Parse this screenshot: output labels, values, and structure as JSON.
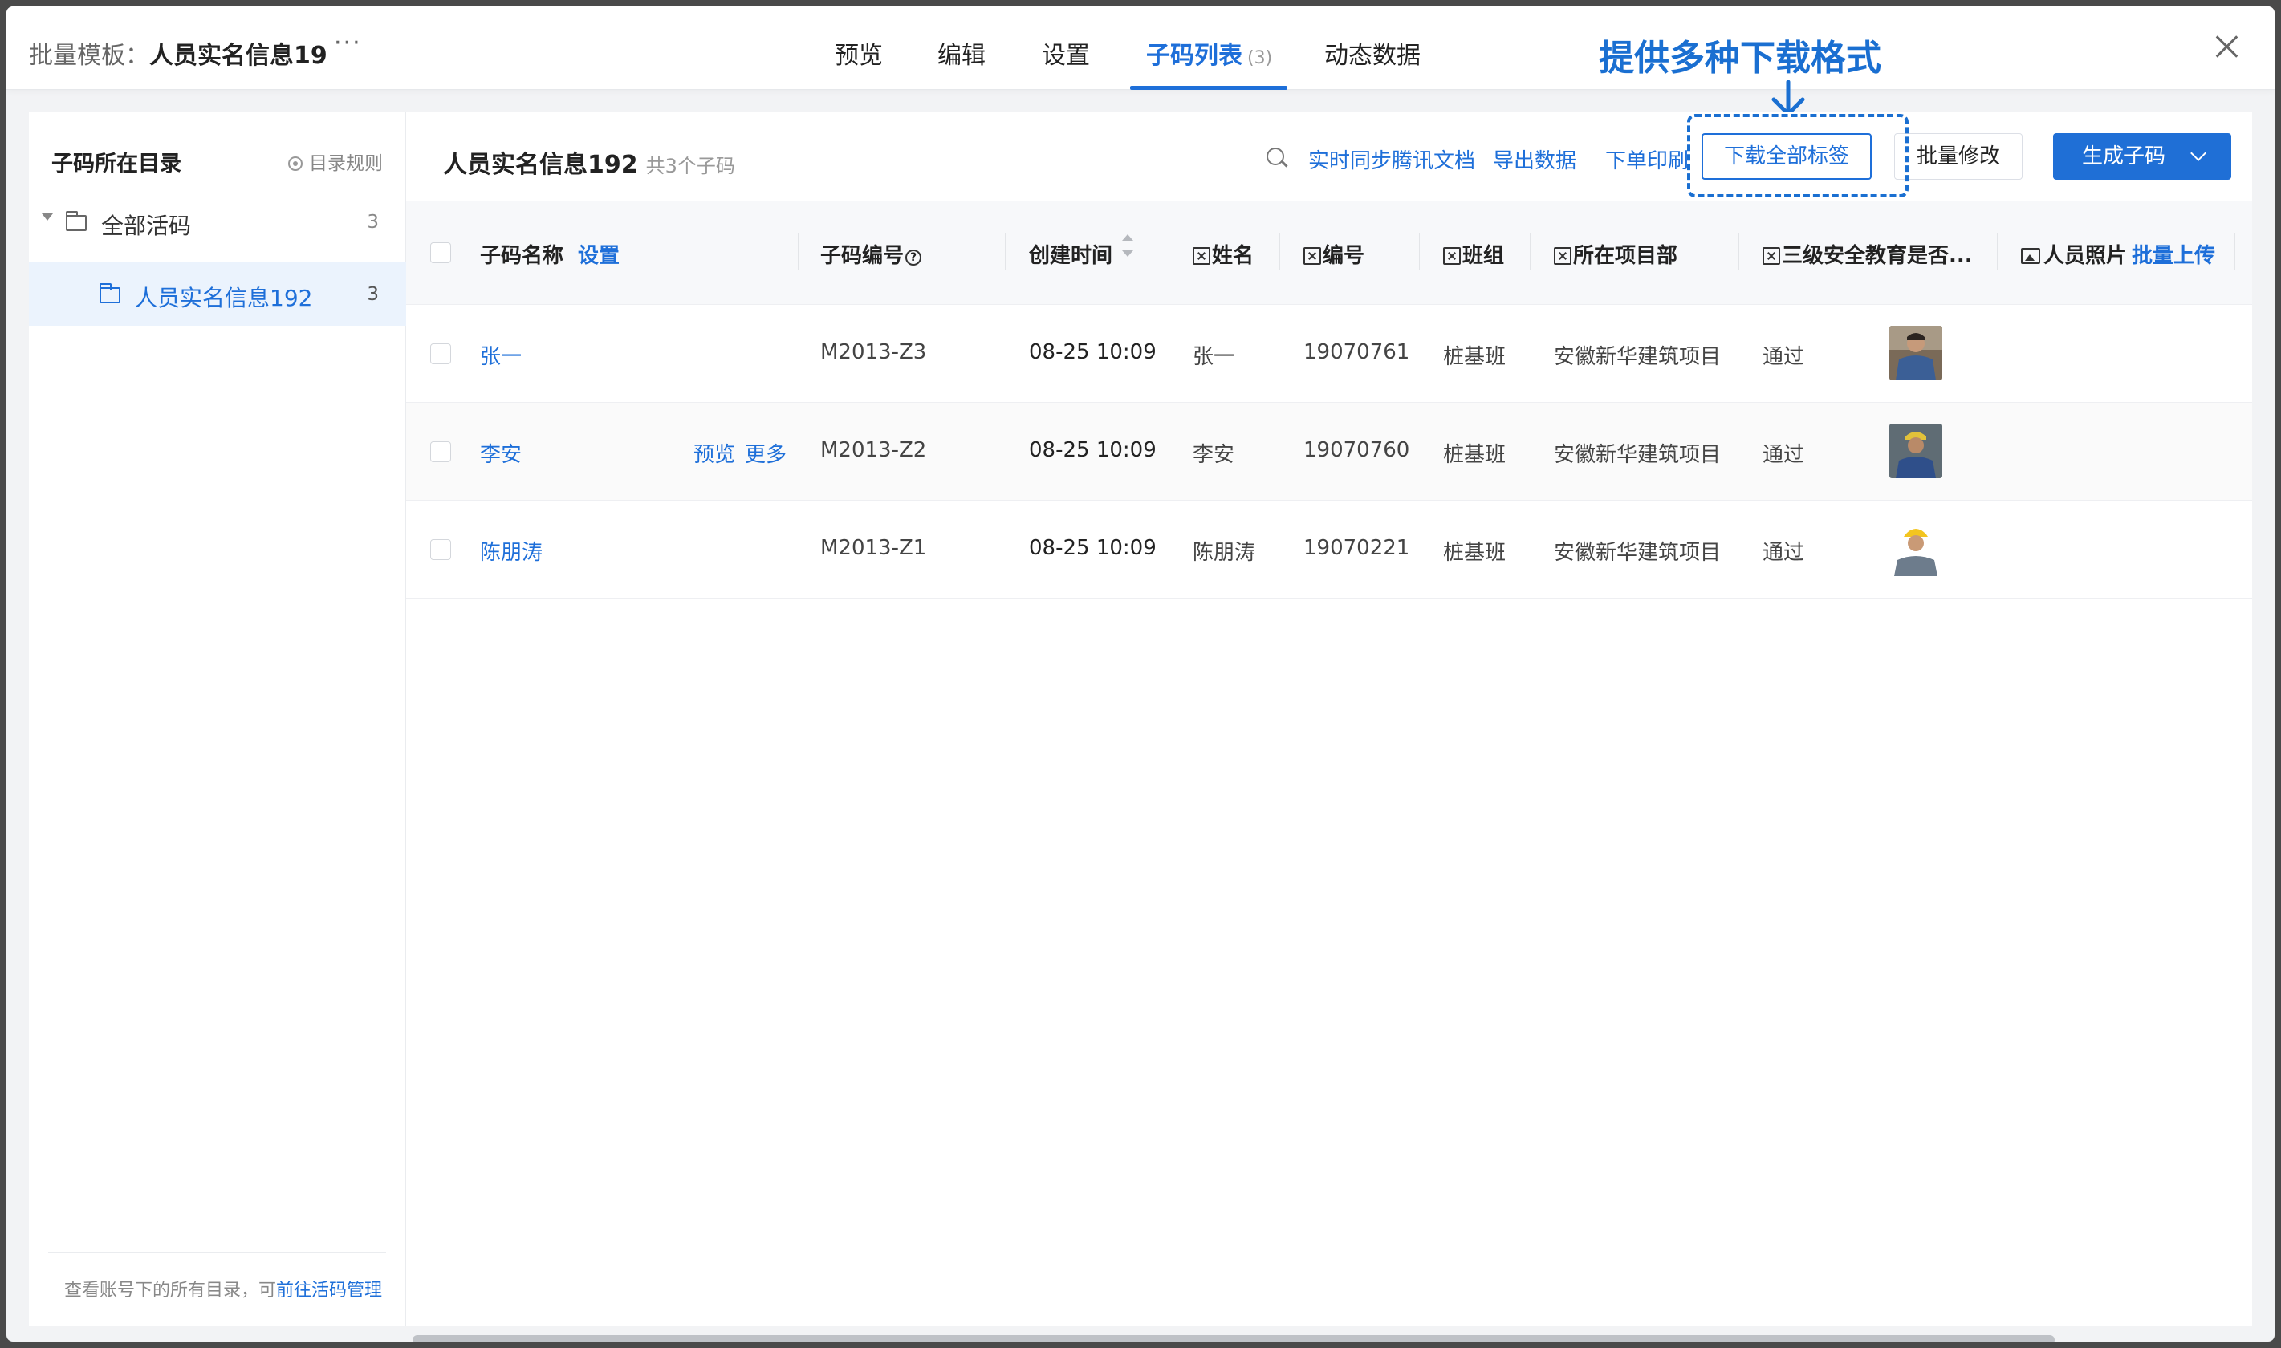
{
  "header": {
    "title_prefix": "批量模板：",
    "title_name": "人员实名信息19",
    "more": "···",
    "tabs": [
      {
        "label": "预览"
      },
      {
        "label": "编辑"
      },
      {
        "label": "设置"
      },
      {
        "label": "子码列表",
        "count": "(3)",
        "active": true
      },
      {
        "label": "动态数据"
      }
    ]
  },
  "annotation": {
    "text": "提供多种下载格式"
  },
  "sidebar": {
    "title": "子码所在目录",
    "rule_label": "目录规则",
    "items": [
      {
        "label": "全部活码",
        "count": "3"
      },
      {
        "label": "人员实名信息192",
        "count": "3",
        "selected": true
      }
    ],
    "footer_text": "查看账号下的所有目录，可",
    "footer_link": "前往活码管理"
  },
  "main": {
    "title": "人员实名信息192",
    "subtitle": "共3个子码",
    "toolbar": {
      "sync": "实时同步腾讯文档",
      "export": "导出数据",
      "print": "下单印刷",
      "download_all": "下载全部标签",
      "batch_edit": "批量修改",
      "generate": "生成子码"
    },
    "columns": {
      "name": "子码名称",
      "name_setting": "设置",
      "code": "子码编号",
      "created": "创建时间",
      "person": "姓名",
      "number": "编号",
      "team": "班组",
      "project": "所在项目部",
      "education": "三级安全教育是否...",
      "photo": "人员照片",
      "photo_upload": "批量上传"
    },
    "rows": [
      {
        "name": "张一",
        "code": "M2013-Z3",
        "created": "08-25 10:09",
        "person": "张一",
        "number": "19070761",
        "team": "桩基班",
        "project": "安徽新华建筑项目",
        "education": "通过"
      },
      {
        "name": "李安",
        "code": "M2013-Z2",
        "created": "08-25 10:09",
        "person": "李安",
        "number": "19070760",
        "team": "桩基班",
        "project": "安徽新华建筑项目",
        "education": "通过",
        "actions": [
          "预览",
          "更多"
        ]
      },
      {
        "name": "陈朋涛",
        "code": "M2013-Z1",
        "created": "08-25 10:09",
        "person": "陈朋涛",
        "number": "19070221",
        "team": "桩基班",
        "project": "安徽新华建筑项目",
        "education": "通过"
      }
    ]
  },
  "colors": {
    "accent": "#1e6fd9",
    "annotation": "#1a6fd1",
    "selected_bg": "#ebf3fd"
  }
}
